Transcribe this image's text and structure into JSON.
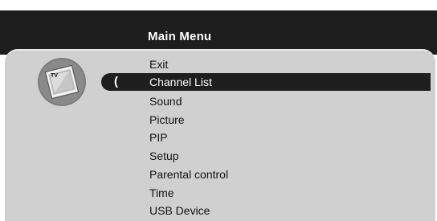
{
  "menu": {
    "title": "Main Menu",
    "selected_index": 1,
    "items": [
      {
        "label": "Exit"
      },
      {
        "label": "Channel List"
      },
      {
        "label": "Sound"
      },
      {
        "label": "Picture"
      },
      {
        "label": "PIP"
      },
      {
        "label": "Setup"
      },
      {
        "label": "Parental control"
      },
      {
        "label": "Time"
      },
      {
        "label": "USB Device"
      }
    ]
  },
  "icon": {
    "name": "tv-icon",
    "label": "TV"
  },
  "cursor": {
    "glyph": "("
  },
  "colors": {
    "header_bg": "#1e1e1e",
    "panel_bg": "#d0d0d0",
    "highlight_bg": "#1e1e1e",
    "text": "#111111",
    "highlight_text": "#ffffff"
  }
}
